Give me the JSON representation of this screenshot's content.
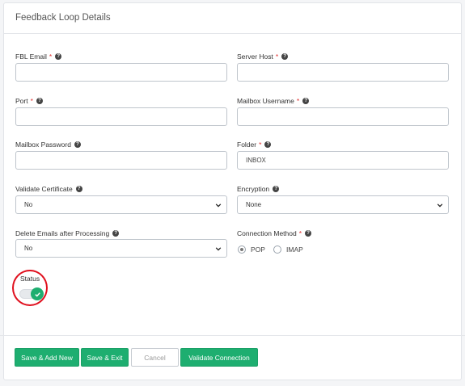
{
  "title": "Feedback Loop Details",
  "fields": {
    "fbl_email": {
      "label": "FBL Email",
      "required": "*",
      "value": ""
    },
    "server_host": {
      "label": "Server Host",
      "required": "*",
      "value": ""
    },
    "port": {
      "label": "Port",
      "required": "*",
      "value": ""
    },
    "mailbox_username": {
      "label": "Mailbox Username",
      "required": "*",
      "value": ""
    },
    "mailbox_password": {
      "label": "Mailbox Password",
      "value": ""
    },
    "folder": {
      "label": "Folder",
      "required": "*",
      "value": "INBOX"
    },
    "validate_certificate": {
      "label": "Validate Certificate",
      "value": "No"
    },
    "encryption": {
      "label": "Encryption",
      "value": "None"
    },
    "delete_emails": {
      "label": "Delete Emails after Processing",
      "value": "No"
    },
    "connection_method": {
      "label": "Connection Method",
      "required": "*",
      "options": [
        "POP",
        "IMAP"
      ],
      "selected": "POP"
    },
    "status": {
      "label": "Status",
      "enabled": true
    }
  },
  "buttons": {
    "save_add_new": "Save & Add New",
    "save_exit": "Save & Exit",
    "cancel": "Cancel",
    "validate_connection": "Validate Connection"
  },
  "colors": {
    "accent": "#1eae70",
    "required": "#e03131",
    "highlight_circle": "#e0101e"
  }
}
